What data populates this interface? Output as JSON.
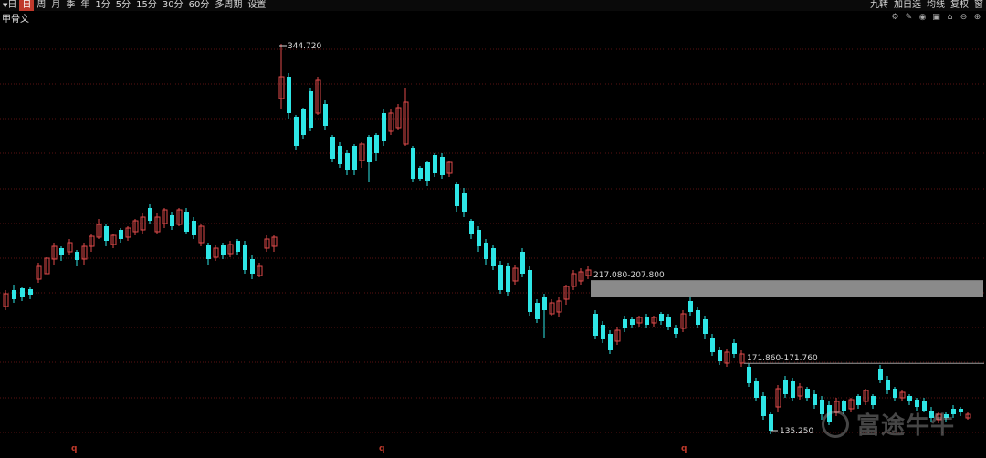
{
  "toolbar": {
    "left_items": [
      {
        "label": "日",
        "active": false,
        "prefix": "▼"
      },
      {
        "label": "日",
        "active": true
      },
      {
        "label": "周",
        "active": false
      },
      {
        "label": "月",
        "active": false
      },
      {
        "label": "季",
        "active": false
      },
      {
        "label": "年",
        "active": false
      },
      {
        "label": "1分",
        "active": false
      },
      {
        "label": "5分",
        "active": false
      },
      {
        "label": "15分",
        "active": false
      },
      {
        "label": "30分",
        "active": false
      },
      {
        "label": "60分",
        "active": false
      },
      {
        "label": "多周期",
        "active": false
      },
      {
        "label": "设置",
        "active": false
      }
    ],
    "right_items": [
      "九转",
      "加自选",
      "均线",
      "复权",
      "窗"
    ]
  },
  "stock_name": "甲骨文",
  "colors": {
    "up": "#e04a4a",
    "down": "#2ee6e6",
    "grid": "#5a1212",
    "zone": "#8a8a8a",
    "label": "#d8d8d8",
    "month_label": "#c0392b"
  },
  "annotations": {
    "high": "344.720",
    "low": "135.250",
    "zone1": "217.080-207.800",
    "zone2": "171.860-171.760"
  },
  "watermark": "富途牛牛",
  "month_markers": [
    "q",
    "q",
    "q"
  ],
  "chart_data": {
    "type": "candlestick",
    "visible_high": 344.72,
    "visible_low": 135.25,
    "zones": [
      {
        "label": "217.080-207.800",
        "top": 217.08,
        "bottom": 207.8
      },
      {
        "label": "171.860-171.760",
        "top": 171.86,
        "bottom": 171.76
      }
    ]
  }
}
